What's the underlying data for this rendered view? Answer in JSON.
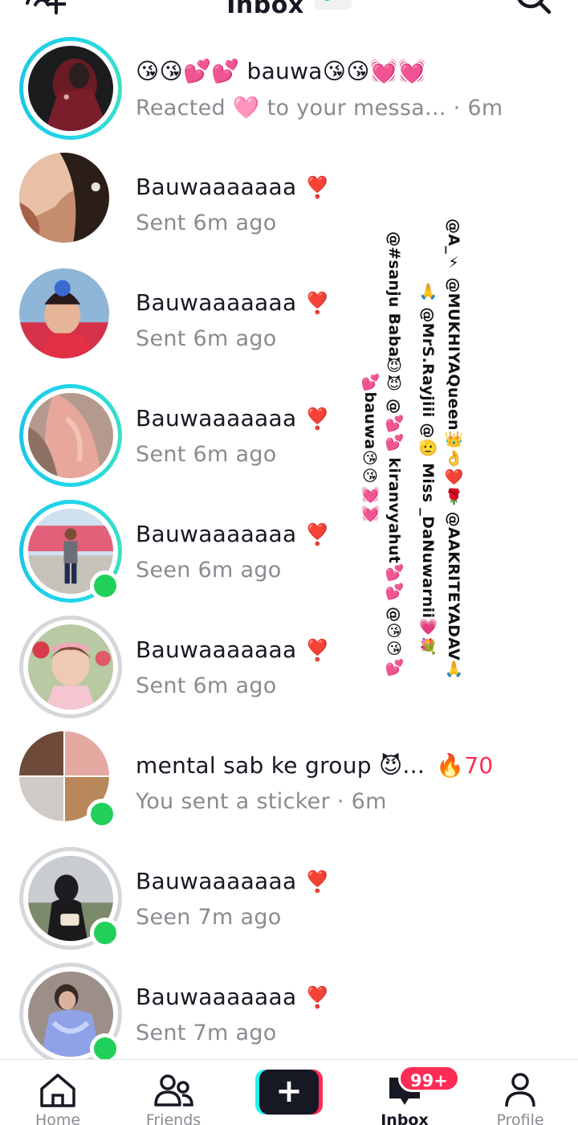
{
  "header": {
    "title": "Inbox",
    "active_status": "online"
  },
  "conversations": [
    {
      "title": "😘😘💕💕 bauwa😘😘💓💓",
      "subtitle": "Reacted 🩷 to your messa... · 6m",
      "ring": "story",
      "online": false
    },
    {
      "title": "Bauwaaaaaaa",
      "heart": "❣️",
      "subtitle": "Sent 6m ago",
      "ring": "none",
      "online": false
    },
    {
      "title": "Bauwaaaaaaa",
      "heart": "❣️",
      "subtitle": "Sent 6m ago",
      "ring": "none",
      "online": false
    },
    {
      "title": "Bauwaaaaaaa",
      "heart": "❣️",
      "subtitle": "Sent 6m ago",
      "ring": "story",
      "online": false
    },
    {
      "title": "Bauwaaaaaaa",
      "heart": "❣️",
      "subtitle": "Seen 6m ago",
      "ring": "story",
      "online": true
    },
    {
      "title": "Bauwaaaaaaa",
      "heart": "❣️",
      "subtitle": "Sent 6m ago",
      "ring": "seen",
      "online": false
    },
    {
      "title": "mental sab ke group 😈...",
      "streak_icon": "🔥",
      "streak": "70",
      "subtitle": "You sent a sticker · 6m",
      "ring": "none",
      "online": true
    },
    {
      "title": "Bauwaaaaaaa",
      "heart": "❣️",
      "subtitle": "Seen 7m ago",
      "ring": "seen",
      "online": true
    },
    {
      "title": "Bauwaaaaaaa",
      "heart": "❣️",
      "subtitle": "Sent 7m ago",
      "ring": "seen",
      "online": true
    }
  ],
  "overlay_text": {
    "col1": "@A_⚡ @MUKHIYAQueen👑👌❤️🌹 @AAKRITEYADAV🙏",
    "col2": "🙏 @MrS.Rayjiii @🫡 Miss _DaNuwarnii💗💐",
    "col3": "@#sanju Baba😈😈 @💕💕 kiranvyahut💕💕 @😘😘💕",
    "col4": "💕bauwa😘😘💓💓"
  },
  "bottom_nav": {
    "home": "Home",
    "friends": "Friends",
    "create": "+",
    "inbox": "Inbox",
    "inbox_badge": "99+",
    "profile": "Profile"
  },
  "colors": {
    "accent": "#fe2c55",
    "story_ring": "#20d5ec",
    "online": "#20d05a",
    "secondary_text": "#8a8b91"
  }
}
